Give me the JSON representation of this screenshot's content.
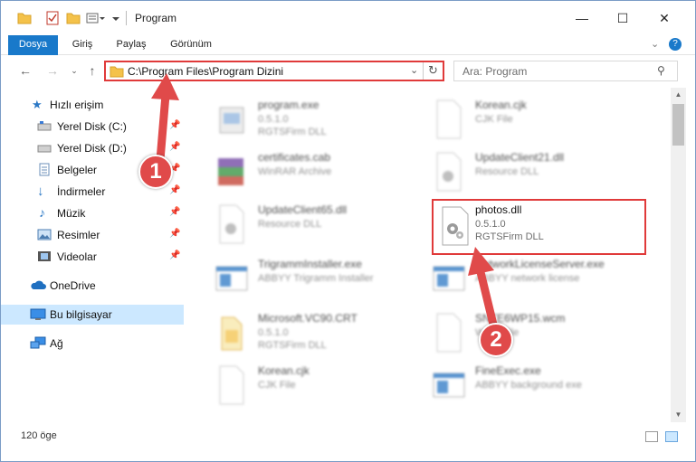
{
  "window": {
    "title": "Program",
    "controls": {
      "minimize": "—",
      "maximize": "☐",
      "close": "✕"
    }
  },
  "ribbon": {
    "tabs": [
      "Dosya",
      "Giriş",
      "Paylaş",
      "Görünüm"
    ],
    "accent": "#1979ca"
  },
  "address": {
    "path": "C:\\Program Files\\Program Dizini"
  },
  "search": {
    "placeholder": "Ara: Program"
  },
  "sidebar": {
    "items": [
      {
        "label": "Hızlı erişim",
        "icon": "star-icon"
      },
      {
        "label": "Yerel Disk (C:)",
        "icon": "drive-icon",
        "pinned": true
      },
      {
        "label": "Yerel Disk (D:)",
        "icon": "drive-icon",
        "pinned": true
      },
      {
        "label": "Belgeler",
        "icon": "document-icon",
        "pinned": true
      },
      {
        "label": "İndirmeler",
        "icon": "download-icon",
        "pinned": true
      },
      {
        "label": "Müzik",
        "icon": "music-icon",
        "pinned": true
      },
      {
        "label": "Resimler",
        "icon": "pictures-icon",
        "pinned": true
      },
      {
        "label": "Videolar",
        "icon": "video-icon",
        "pinned": true
      },
      {
        "label": "OneDrive",
        "icon": "cloud-icon"
      },
      {
        "label": "Bu bilgisayar",
        "icon": "computer-icon",
        "selected": true
      },
      {
        "label": "Ağ",
        "icon": "network-icon"
      }
    ]
  },
  "files": [
    {
      "name": "program.exe",
      "meta1": "0.5.1.0",
      "meta2": "RGTSFirm DLL",
      "icon": "exe-icon"
    },
    {
      "name": "Korean.cjk",
      "meta1": "CJK File",
      "meta2": "",
      "icon": "blank-file-icon"
    },
    {
      "name": "certificates.cab",
      "meta1": "WinRAR Archive",
      "meta2": "",
      "icon": "archive-icon"
    },
    {
      "name": "UpdateClient21.dll",
      "meta1": "Resource DLL",
      "meta2": "",
      "icon": "dll-icon"
    },
    {
      "name": "UpdateClient65.dll",
      "meta1": "Resource DLL",
      "meta2": "",
      "icon": "dll-icon"
    },
    {
      "name": "photos.dll",
      "meta1": "0.5.1.0",
      "meta2": "RGTSFirm DLL",
      "icon": "dll-gear-icon"
    },
    {
      "name": "TrigrammInstaller.exe",
      "meta1": "ABBYY Trigramm Installer",
      "meta2": "",
      "icon": "app-window-icon"
    },
    {
      "name": "NetworkLicenseServer.exe",
      "meta1": "ABBYY network license",
      "meta2": "",
      "icon": "app-window-icon"
    },
    {
      "name": "Microsoft.VC90.CRT",
      "meta1": "0.5.1.0",
      "meta2": "RGTSFirm DLL",
      "icon": "folder-icon"
    },
    {
      "name": "SNTE6WP15.wcm",
      "meta1": "WCM File",
      "meta2": "",
      "icon": "blank-file-icon"
    },
    {
      "name": "Korean.cjk",
      "meta1": "CJK File",
      "meta2": "",
      "icon": "blank-file-icon"
    },
    {
      "name": "FineExec.exe",
      "meta1": "ABBYY background exe",
      "meta2": "",
      "icon": "app-window-icon"
    }
  ],
  "status": {
    "item_count": "120 öge"
  },
  "callouts": [
    "1",
    "2"
  ],
  "colors": {
    "highlight": "#e03a3a",
    "selected_bg": "#cce8ff"
  }
}
